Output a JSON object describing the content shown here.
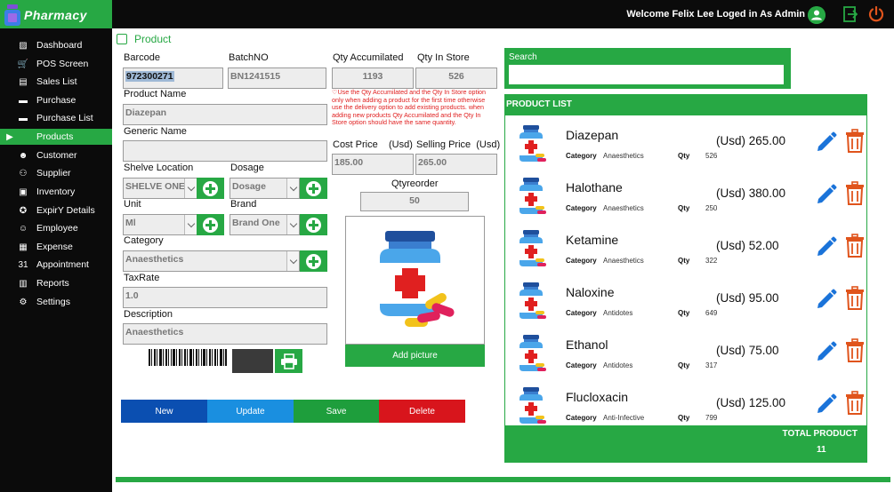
{
  "app": {
    "name": "Pharmacy"
  },
  "topbar": {
    "welcome": "Welcome Felix Lee Loged in As Admin"
  },
  "sidebar": {
    "items": [
      {
        "label": "Dashboard",
        "icon": "dashboard-icon",
        "glyph": "▨",
        "active": false
      },
      {
        "label": "POS Screen",
        "icon": "cart-icon",
        "glyph": "🛒",
        "active": false
      },
      {
        "label": "Sales List",
        "icon": "list-icon",
        "glyph": "▤",
        "active": false
      },
      {
        "label": "Purchase",
        "icon": "truck-icon",
        "glyph": "▬",
        "active": false
      },
      {
        "label": "Purchase List",
        "icon": "truck-list-icon",
        "glyph": "▬",
        "active": false
      },
      {
        "label": "Products",
        "icon": "play-icon",
        "glyph": "▶",
        "active": true
      },
      {
        "label": "Customer",
        "icon": "customer-icon",
        "glyph": "☻",
        "active": false
      },
      {
        "label": "Supplier",
        "icon": "supplier-icon",
        "glyph": "⚇",
        "active": false
      },
      {
        "label": "Inventory",
        "icon": "inventory-icon",
        "glyph": "▣",
        "active": false
      },
      {
        "label": "ExpirY Details",
        "icon": "expiry-icon",
        "glyph": "✪",
        "active": false
      },
      {
        "label": "Employee",
        "icon": "employee-icon",
        "glyph": "☺",
        "active": false
      },
      {
        "label": "Expense",
        "icon": "expense-icon",
        "glyph": "▦",
        "active": false
      },
      {
        "label": "Appointment",
        "icon": "calendar-icon",
        "glyph": "31",
        "active": false
      },
      {
        "label": "Reports",
        "icon": "report-icon",
        "glyph": "▥",
        "active": false
      },
      {
        "label": "Settings",
        "icon": "gear-icon",
        "glyph": "⚙",
        "active": false
      }
    ]
  },
  "page": {
    "title": "Product"
  },
  "form": {
    "barcode_label": "Barcode",
    "barcode_value": "972300271",
    "batch_label": "BatchNO",
    "batch_value": "BN1241515",
    "qty_acc_label": "Qty Accumilated",
    "qty_acc_value": "1193",
    "qty_store_label": "Qty In Store",
    "qty_store_value": "526",
    "note": "Use the Qty Accumilated and the Qty In Store option only when adding a product for the first time otherwise use the delivery option to add existing products. when adding new products Qty Accumilated and the Qty In Store option should have the same quantity.",
    "product_name_label": "Product Name",
    "product_name_value": "Diazepan",
    "generic_name_label": "Generic Name",
    "generic_name_value": "",
    "cost_price_label": "Cost Price",
    "cost_price_unit": "(Usd)",
    "cost_price_value": "185.00",
    "selling_price_label": "Selling Price",
    "selling_price_unit": "(Usd)",
    "selling_price_value": "265.00",
    "shelve_label": "Shelve Location",
    "shelve_value": "SHELVE ONE",
    "dosage_label": "Dosage",
    "dosage_value": "Dosage",
    "qtyreorder_label": "Qtyreorder",
    "qtyreorder_value": "50",
    "unit_label": "Unit",
    "unit_value": "Ml",
    "brand_label": "Brand",
    "brand_value": "Brand One",
    "category_label": "Category",
    "category_value": "Anaesthetics",
    "taxrate_label": "TaxRate",
    "taxrate_value": "1.0",
    "description_label": "Description",
    "description_value": "Anaesthetics",
    "add_picture_label": "Add picture"
  },
  "actions": {
    "new": "New",
    "update": "Update",
    "save": "Save",
    "delete": "Delete"
  },
  "action_colors": {
    "new": "#0b4fb1",
    "update": "#1a8fe0",
    "save": "#1e9e3c",
    "delete": "#d8151c"
  },
  "search": {
    "label": "Search",
    "value": ""
  },
  "product_list": {
    "title": "PRODUCT LIST",
    "category_label": "Category",
    "qty_label": "Qty",
    "currency": "(Usd)",
    "items": [
      {
        "name": "Diazepan",
        "category": "Anaesthetics",
        "qty": "526",
        "price": "(Usd) 265.00"
      },
      {
        "name": "Halothane",
        "category": "Anaesthetics",
        "qty": "250",
        "price": "(Usd) 380.00"
      },
      {
        "name": "Ketamine",
        "category": "Anaesthetics",
        "qty": "322",
        "price": "(Usd) 52.00"
      },
      {
        "name": "Naloxine",
        "category": "Antidotes",
        "qty": "649",
        "price": "(Usd) 95.00"
      },
      {
        "name": "Ethanol",
        "category": "Antidotes",
        "qty": "317",
        "price": "(Usd) 75.00"
      },
      {
        "name": "Flucloxacin",
        "category": "Anti-Infective",
        "qty": "799",
        "price": "(Usd) 125.00"
      }
    ],
    "total_label": "TOTAL PRODUCT",
    "total_value": "11"
  },
  "colors": {
    "accent": "#27a844",
    "dark": "#0b0b0b",
    "edit": "#1a73d9",
    "delete": "#e0541c"
  }
}
